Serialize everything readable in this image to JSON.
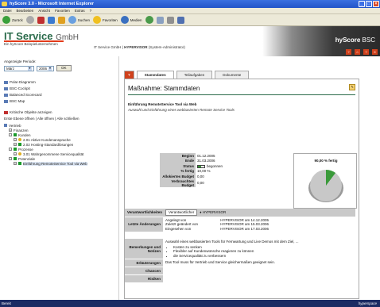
{
  "window": {
    "title": "hyScore 3.0 - Microsoft Internet Explorer",
    "buttons": [
      "_",
      "□",
      "×"
    ]
  },
  "menubar": [
    "Datei",
    "Bearbeiten",
    "Ansicht",
    "Favoriten",
    "Extras",
    "?"
  ],
  "toolbar": {
    "back": "Zurück",
    "search": "Suchen",
    "favorites": "Favoriten",
    "media": "Medien"
  },
  "header": {
    "logo_main": "IT Service",
    "logo_suffix": "GmbH",
    "logo_sub": "Ein hyScore Beispielunternehmen",
    "company": "IT Service GmbH |",
    "user": "HYPERVISOR",
    "role": "(System-Administrator)",
    "brand_bold": "hyScore",
    "brand_rest": " BSC",
    "icons": [
      "?",
      "⌂",
      "?",
      "X"
    ]
  },
  "sidebar": {
    "period_label": "Angezeigte Periode:",
    "month": "März",
    "year": "2006",
    "ok": "OK",
    "links": [
      "Polar-Diagramm",
      "BSC-Cockpit",
      "Balanced Scorecard",
      "BSC Map"
    ],
    "critical": "Kritische Objekte anzeigen",
    "expand": "Erste Ebene öffnen | Alle öffnen | Alle schließen",
    "tree": [
      {
        "label": "Vertrieb",
        "indent": 0
      },
      {
        "label": "Finanzen",
        "indent": 1
      },
      {
        "label": "Kunden",
        "indent": 1
      },
      {
        "label": "2.01 Aktive Kundenansprache",
        "indent": 2
      },
      {
        "label": "2.02 Hosting-Standardlösungen",
        "indent": 2
      },
      {
        "label": "Prozesse",
        "indent": 1
      },
      {
        "label": "3.01 Wahrgenommene Servicequalität",
        "indent": 2
      },
      {
        "label": "Potenziale",
        "indent": 1
      },
      {
        "label": "Einführung RemoteService Tool via Web",
        "indent": 2
      }
    ]
  },
  "tabs": {
    "help": "?",
    "items": [
      "Stammdaten",
      "Teilaufgaben",
      "Dokumente"
    ]
  },
  "panel": {
    "title": "Maßnahme: Stammdaten",
    "subtitle": "Einführung RemoteService Tool via Web",
    "description": "Auswahl und Einführung eines webbasierten Remote Service Tools",
    "fields": [
      {
        "k": "Beginn",
        "v": "01.12.2005"
      },
      {
        "k": "Ende",
        "v": "31.03.2006"
      },
      {
        "k": "Status",
        "v": "begonnen"
      },
      {
        "k": "% fertig",
        "v": "10,00 %"
      },
      {
        "k": "Allokiertes Budget",
        "v": "0,00"
      },
      {
        "k": "Verbrauchtes Budget",
        "v": "0,00"
      }
    ],
    "chart_label": "90,00 % fertig",
    "resp_label": "Verantwortlichkeiten",
    "resp_pill": "Verantwortlicher",
    "resp_user": "HYPERVISOR",
    "changes_label": "Letzte Änderungen",
    "changes": [
      {
        "a": "Angelegt von",
        "u": "HYPERVISOR",
        "d": "am 14.12.2005"
      },
      {
        "a": "Zuletzt geändert von",
        "u": "HYPERVISOR",
        "d": "am 15.03.2006"
      },
      {
        "a": "Eingesehen von",
        "u": "HYPERVISOR",
        "d": "am 17.03.2006"
      }
    ],
    "remarks_label": "Bemerkungen und Notizen",
    "remarks_text": "Auswahl eines webbasierten Tools für Fernwartung und Live Demos mit dem Ziel, ...",
    "remarks_bullets": [
      "Kosten zu senken",
      "Flexibler auf Kundenwünsche reagieren zu können",
      "die Servicequalität zu verbessern"
    ],
    "expl_label": "Erläuterungen",
    "expl_text": "Das Tool muss für Vertrieb und Service gleichermaßen geeignet sein.",
    "chances_label": "Chancen",
    "risks_label": "Risiken"
  },
  "statusbar": {
    "left": "Bereit",
    "right": "hyperspace"
  },
  "colors": {
    "accent_green": "#2a6a4a",
    "header_red": "#d0411c",
    "pie_grey": "#c8c8c8",
    "pie_green": "#3a9a3a"
  }
}
